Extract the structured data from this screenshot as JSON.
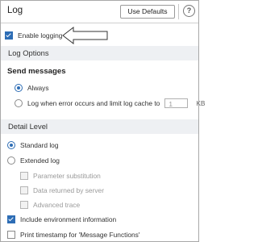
{
  "window": {
    "title": "Log",
    "defaults_button": "Use Defaults",
    "help_icon": "?"
  },
  "enable_logging": {
    "label": "Enable logging",
    "checked": true
  },
  "log_options": {
    "header": "Log Options",
    "send_messages": {
      "title": "Send messages",
      "always": {
        "label": "Always",
        "selected": true
      },
      "on_error": {
        "label": "Log when error occurs and limit log cache to",
        "selected": false,
        "value": "1",
        "unit": "KB"
      }
    }
  },
  "detail_level": {
    "header": "Detail Level",
    "standard": {
      "label": "Standard log",
      "selected": true
    },
    "extended": {
      "label": "Extended log",
      "selected": false
    },
    "sub_options": [
      {
        "label": "Parameter substitution",
        "checked": false,
        "enabled": false
      },
      {
        "label": "Data returned by server",
        "checked": false,
        "enabled": false
      },
      {
        "label": "Advanced trace",
        "checked": false,
        "enabled": false
      }
    ],
    "include_env": {
      "label": "Include environment information",
      "checked": true
    },
    "print_timestamp": {
      "label": "Print timestamp for 'Message Functions'",
      "checked": false
    }
  },
  "colors": {
    "accent": "#2d6db5",
    "section_bg": "#eef0f3",
    "disabled_text": "#9a9a9a"
  }
}
